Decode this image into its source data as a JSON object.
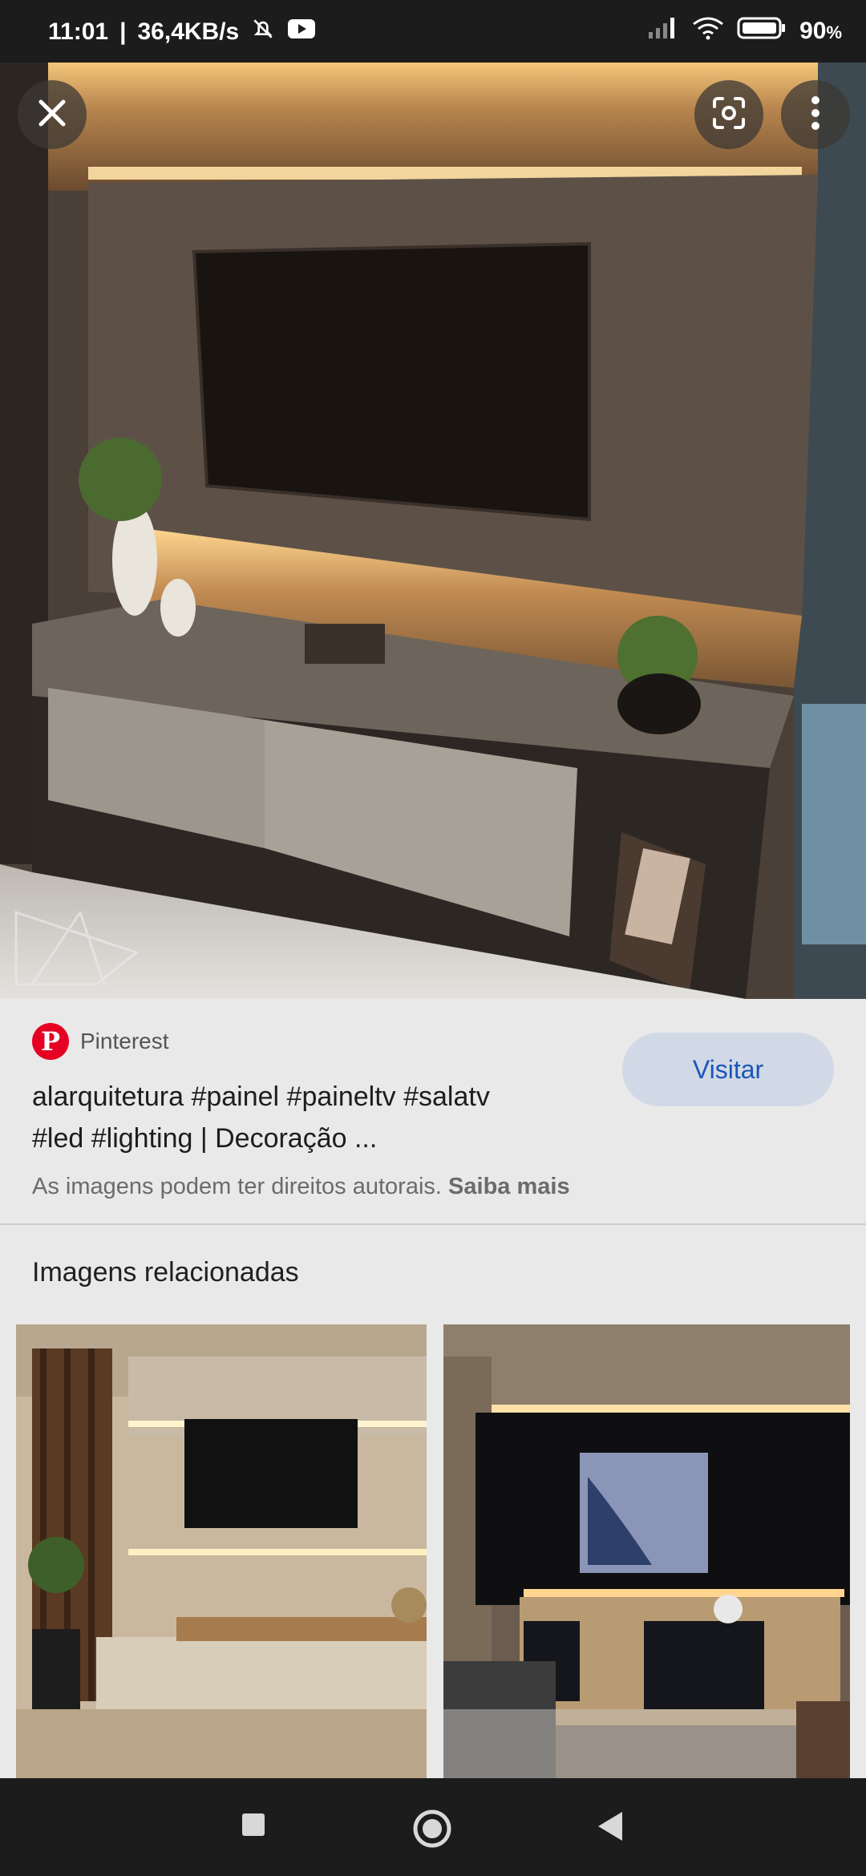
{
  "status_bar": {
    "time": "11:01",
    "separator": "|",
    "network_speed": "36,4KB/s",
    "battery": "90",
    "battery_unit": "%"
  },
  "hero": {
    "watermark": "AL"
  },
  "source": {
    "name": "Pinterest",
    "logo_letter": "P"
  },
  "result": {
    "title_line1": "alarquitetura #painel #paineltv #salatv",
    "title_line2": "#led #lighting | Decoração ...",
    "visit_label": "Visitar",
    "rights_text": "As imagens podem ter direitos autorais.",
    "rights_link": "Saiba mais"
  },
  "related": {
    "title": "Imagens relacionadas"
  },
  "colors": {
    "accent": "#1a56b8",
    "pinterest": "#e60023",
    "bars": "#1c1c1c"
  }
}
